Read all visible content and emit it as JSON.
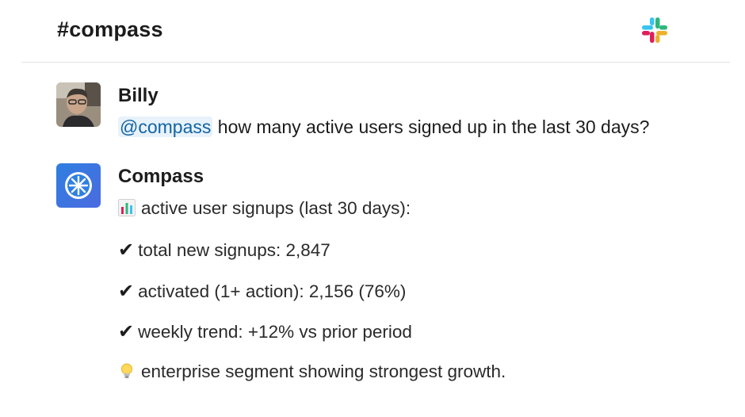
{
  "channel": {
    "title": "#compass"
  },
  "messages": [
    {
      "author": "Billy",
      "mention": "@compass",
      "text": " how many active users signed up in the last 30 days?"
    },
    {
      "author": "Compass",
      "lines": [
        {
          "icon": "bar-chart-emoji",
          "text": "active user signups (last 30 days):"
        },
        {
          "icon": "check-mark",
          "mark": "✔",
          "text": "total new signups: 2,847"
        },
        {
          "icon": "check-mark",
          "mark": "✔",
          "text": "activated (1+ action): 2,156 (76%)"
        },
        {
          "icon": "check-mark",
          "mark": "✔",
          "text": "weekly trend: +12% vs prior period"
        },
        {
          "icon": "lightbulb-emoji",
          "text": "enterprise segment showing strongest growth."
        }
      ]
    }
  ],
  "colors": {
    "mention_bg": "#e8f2fb",
    "mention_text": "#1264a3",
    "compass_avatar": "#2f7fe0",
    "slack_blue": "#36c5f0",
    "slack_green": "#2eb67d",
    "slack_red": "#e01e5a",
    "slack_yellow": "#ecb22e"
  }
}
